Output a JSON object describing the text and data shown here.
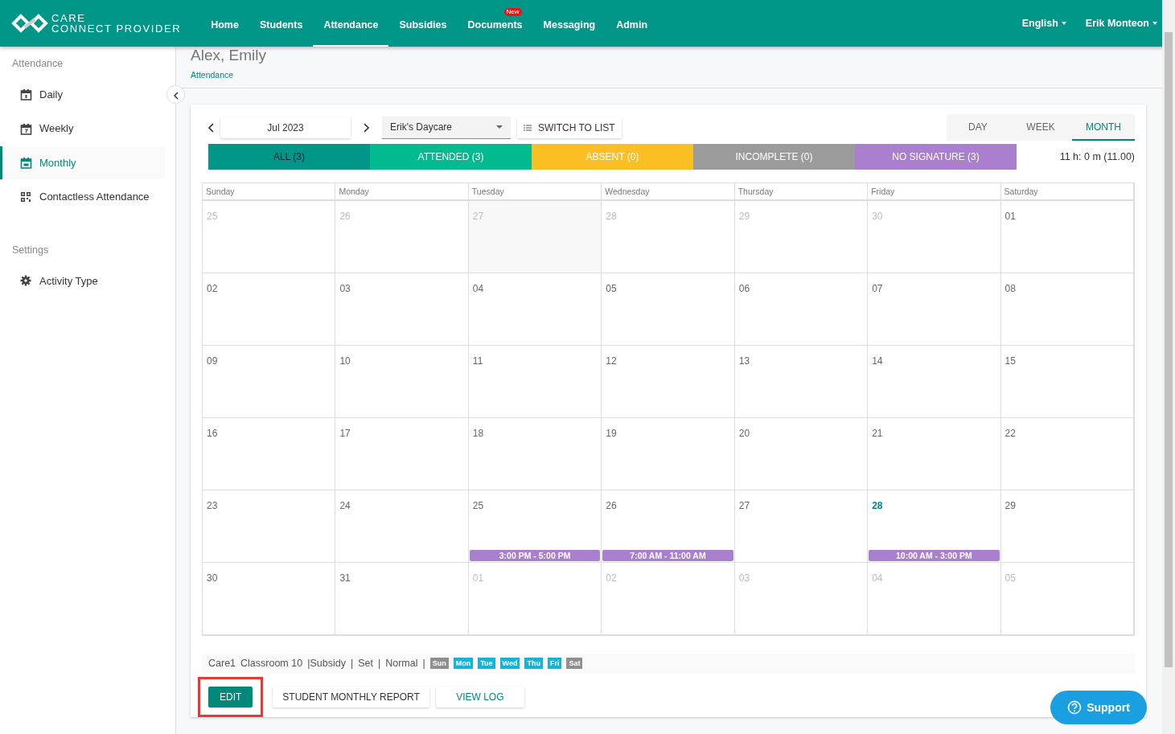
{
  "navbar": {
    "brand": [
      "CARE",
      "CONNECT PROVIDER"
    ],
    "items": [
      {
        "label": "Home",
        "selected": false
      },
      {
        "label": "Students",
        "selected": false
      },
      {
        "label": "Attendance",
        "selected": true
      },
      {
        "label": "Subsidies",
        "selected": false
      },
      {
        "label": "Documents",
        "selected": false,
        "badge": "New"
      },
      {
        "label": "Messaging",
        "selected": false
      },
      {
        "label": "Admin",
        "selected": false
      }
    ],
    "menus": [
      "English",
      "Erik Monteon"
    ]
  },
  "sidebar": [
    {
      "title": "Attendance",
      "items": [
        {
          "label": "Daily",
          "kind": "day",
          "selected": false
        },
        {
          "label": "Weekly",
          "kind": "week",
          "selected": false
        },
        {
          "label": "Monthly",
          "kind": "month",
          "selected": true
        },
        {
          "label": "Contactless Attendance",
          "kind": "qr",
          "selected": false
        }
      ]
    },
    {
      "title": "Settings",
      "items": [
        {
          "label": "Activity Type",
          "kind": "gear",
          "selected": false
        }
      ]
    }
  ],
  "page": {
    "title": "Alex, Emily",
    "breadcrumb": "Attendance"
  },
  "calendar": {
    "month": "Jul 2023",
    "location": "Erik's Daycare",
    "switch_button": "SWITCH TO LIST",
    "views": [
      {
        "label": "DAY",
        "selected": false
      },
      {
        "label": "WEEK",
        "selected": false
      },
      {
        "label": "MONTH",
        "selected": true
      }
    ],
    "filters": [
      {
        "label": "ALL (3)",
        "color": "#009688",
        "selected": true
      },
      {
        "label": "ATTENDED (3)",
        "color": "#00bb8f",
        "selected": false
      },
      {
        "label": "ABSENT (0)",
        "color": "#fbbf24",
        "selected": false
      },
      {
        "label": "INCOMPLETE (0)",
        "color": "#9b9b9b",
        "selected": false
      },
      {
        "label": "NO SIGNATURE (3)",
        "color": "#ab7fcf",
        "selected": false
      }
    ],
    "total": "11 h: 0 m (11.00)",
    "weekdays": [
      "Sunday",
      "Monday",
      "Tuesday",
      "Wednesday",
      "Thursday",
      "Friday",
      "Saturday"
    ],
    "weeks": [
      [
        {
          "day": "25",
          "muted": true
        },
        {
          "day": "26",
          "muted": true
        },
        {
          "day": "27",
          "muted": true,
          "hovered": true
        },
        {
          "day": "28",
          "muted": true
        },
        {
          "day": "29",
          "muted": true
        },
        {
          "day": "30",
          "muted": true
        },
        {
          "day": "01",
          "muted": false
        }
      ],
      [
        {
          "day": "02",
          "muted": false
        },
        {
          "day": "03",
          "muted": false
        },
        {
          "day": "04",
          "muted": false
        },
        {
          "day": "05",
          "muted": false
        },
        {
          "day": "06",
          "muted": false
        },
        {
          "day": "07",
          "muted": false
        },
        {
          "day": "08",
          "muted": false
        }
      ],
      [
        {
          "day": "09",
          "muted": false
        },
        {
          "day": "10",
          "muted": false
        },
        {
          "day": "11",
          "muted": false
        },
        {
          "day": "12",
          "muted": false
        },
        {
          "day": "13",
          "muted": false
        },
        {
          "day": "14",
          "muted": false
        },
        {
          "day": "15",
          "muted": false
        }
      ],
      [
        {
          "day": "16",
          "muted": false
        },
        {
          "day": "17",
          "muted": false
        },
        {
          "day": "18",
          "muted": false
        },
        {
          "day": "19",
          "muted": false
        },
        {
          "day": "20",
          "muted": false
        },
        {
          "day": "21",
          "muted": false
        },
        {
          "day": "22",
          "muted": false
        }
      ],
      [
        {
          "day": "23",
          "muted": false
        },
        {
          "day": "24",
          "muted": false
        },
        {
          "day": "25",
          "muted": false,
          "event": "3:00 PM - 5:00 PM"
        },
        {
          "day": "26",
          "muted": false,
          "event": "7:00 AM - 11:00 AM"
        },
        {
          "day": "27",
          "muted": false
        },
        {
          "day": "28",
          "muted": false,
          "today": true,
          "event": "10:00 AM - 3:00 PM"
        },
        {
          "day": "29",
          "muted": false
        }
      ],
      [
        {
          "day": "30",
          "muted": false
        },
        {
          "day": "31",
          "muted": false
        },
        {
          "day": "01",
          "muted": true
        },
        {
          "day": "02",
          "muted": true
        },
        {
          "day": "03",
          "muted": true
        },
        {
          "day": "04",
          "muted": true
        },
        {
          "day": "05",
          "muted": true
        }
      ]
    ]
  },
  "enrollment": {
    "parts": [
      "Care1",
      "Classroom 10",
      "|Subsidy",
      "|",
      "Set",
      "|",
      "Normal",
      "|"
    ],
    "days": [
      {
        "label": "Sun",
        "on": false
      },
      {
        "label": "Mon",
        "on": true
      },
      {
        "label": "Tue",
        "on": true
      },
      {
        "label": "Wed",
        "on": true
      },
      {
        "label": "Thu",
        "on": true
      },
      {
        "label": "Fri",
        "on": true
      },
      {
        "label": "Sat",
        "on": false
      }
    ]
  },
  "actions": [
    {
      "label": "EDIT",
      "kind": "primary",
      "highlighted": true
    },
    {
      "label": "STUDENT MONTHLY REPORT",
      "kind": "plain",
      "highlighted": false
    },
    {
      "label": "VIEW LOG",
      "kind": "link",
      "highlighted": false
    }
  ],
  "support": "Support"
}
